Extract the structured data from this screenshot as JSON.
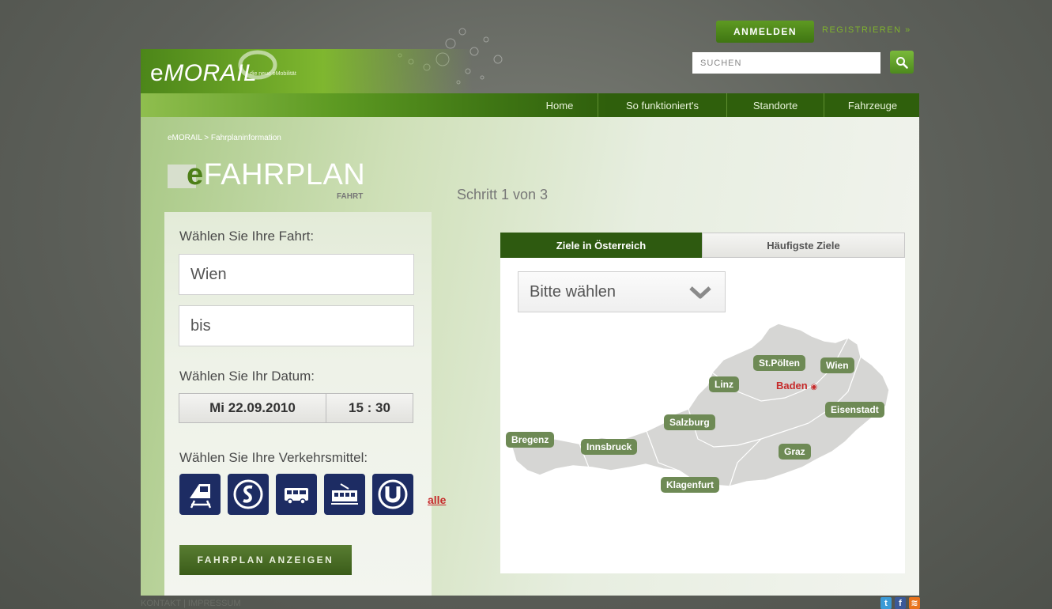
{
  "header": {
    "login_label": "ANMELDEN",
    "register_label": "REGISTRIEREN »",
    "search_placeholder": "SUCHEN",
    "logo_prefix": "e",
    "logo_main": "MORAIL",
    "logo_tagline": "die neue eMobilität"
  },
  "nav": {
    "items": [
      {
        "label": "Home"
      },
      {
        "label": "So funktioniert's"
      },
      {
        "label": "Standorte"
      },
      {
        "label": "Fahrzeuge"
      }
    ]
  },
  "page": {
    "breadcrumb": "eMORAIL > Fahrplaninformation",
    "title_prefix": "e",
    "title_main": "FAHRPLAN",
    "title_sub": "FAHRT",
    "step": "Schritt 1 von 3"
  },
  "form": {
    "trip_label": "Wählen Sie Ihre Fahrt:",
    "from_value": "Wien",
    "to_value": "bis",
    "date_label": "Wählen Sie Ihr Datum:",
    "date_value": "Mi 22.09.2010",
    "time_value": "15 : 30",
    "transport_label": "Wählen Sie Ihre Verkehrsmittel:",
    "transport_icons": [
      "train-icon",
      "s-bahn-icon",
      "bus-icon",
      "tram-icon",
      "u-bahn-icon"
    ],
    "all_link": "alle",
    "submit_label": "FAHRPLAN ANZEIGEN"
  },
  "map": {
    "tabs": [
      {
        "label": "Ziele in Österreich"
      },
      {
        "label": "Häufigste Ziele"
      }
    ],
    "select_value": "Bitte wählen",
    "cities": {
      "stpoelten": "St.Pölten",
      "wien": "Wien",
      "linz": "Linz",
      "baden": "Baden",
      "eisenstadt": "Eisenstadt",
      "salzburg": "Salzburg",
      "bregenz": "Bregenz",
      "innsbruck": "Innsbruck",
      "graz": "Graz",
      "klagenfurt": "Klagenfurt"
    }
  },
  "footer": {
    "links": "KONTAKT | IMPRESSUM"
  },
  "colors": {
    "brand_green": "#3f7512",
    "nav_dark": "#2f5f0c",
    "transport_blue": "#1d2c63",
    "city_green": "#6e8a55",
    "link_red": "#c62a2a"
  }
}
